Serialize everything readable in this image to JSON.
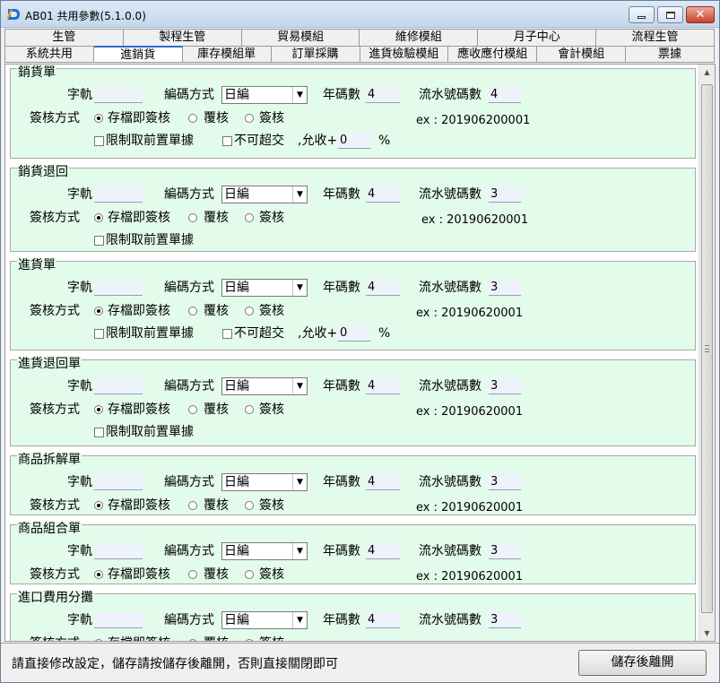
{
  "window": {
    "title": "AB01 共用參數(5.1.0.0)",
    "icon": "app-logo-icon",
    "controls": {
      "minimize": "minimize-icon",
      "maximize": "maximize-icon",
      "close": "✕"
    }
  },
  "tabs_row1": [
    "生管",
    "製程生管",
    "貿易模組",
    "維修模組",
    "月子中心",
    "流程生管"
  ],
  "tabs_row2": [
    "系統共用",
    "進銷貨",
    "庫存模組單",
    "訂單採購",
    "進貨檢驗模組",
    "應收應付模組",
    "會計模組",
    "票據"
  ],
  "active_tab": "進銷貨",
  "labels": {
    "prefix": "字軌",
    "encoding": "編碼方式",
    "year_digits": "年碼數",
    "serial_digits": "流水號碼數",
    "approve_mode": "簽核方式",
    "opt_save_approve": "存檔即簽核",
    "opt_review": "覆核",
    "opt_approve": "簽核",
    "limit_prev": "限制取前置單據",
    "no_overdelivery": "不可超交",
    "allow_plus": ",允收+",
    "percent": "%"
  },
  "sections": [
    {
      "title": "銷貨單",
      "prefix": "",
      "encoding": "日編",
      "year_digits": "4",
      "serial_digits": "4",
      "example": "ex : 201906200001",
      "limit_prev": true,
      "overdelivery": true,
      "allow_plus": "0"
    },
    {
      "title": "銷貨退回",
      "prefix": "",
      "encoding": "日編",
      "year_digits": "4",
      "serial_digits": "3",
      "example": "ex : 20190620001",
      "limit_prev": true,
      "overdelivery": false,
      "allow_plus": ""
    },
    {
      "title": "進貨單",
      "prefix": "",
      "encoding": "日編",
      "year_digits": "4",
      "serial_digits": "3",
      "example": "ex : 20190620001",
      "limit_prev": true,
      "overdelivery": true,
      "allow_plus": "0"
    },
    {
      "title": "進貨退回單",
      "prefix": "",
      "encoding": "日編",
      "year_digits": "4",
      "serial_digits": "3",
      "example": "ex : 20190620001",
      "limit_prev": true,
      "overdelivery": false,
      "allow_plus": ""
    },
    {
      "title": "商品拆解單",
      "prefix": "",
      "encoding": "日編",
      "year_digits": "4",
      "serial_digits": "3",
      "example": "ex : 20190620001",
      "limit_prev": false,
      "overdelivery": false,
      "allow_plus": ""
    },
    {
      "title": "商品組合單",
      "prefix": "",
      "encoding": "日編",
      "year_digits": "4",
      "serial_digits": "3",
      "example": "ex : 20190620001",
      "limit_prev": false,
      "overdelivery": false,
      "allow_plus": ""
    },
    {
      "title": "進口費用分攤",
      "prefix": "",
      "encoding": "日編",
      "year_digits": "4",
      "serial_digits": "3",
      "example": "",
      "limit_prev": false,
      "overdelivery": false,
      "allow_plus": ""
    }
  ],
  "status": {
    "hint": "請直接修改設定，儲存請按儲存後離開，否則直接關閉即可",
    "save_button": "儲存後離開"
  }
}
